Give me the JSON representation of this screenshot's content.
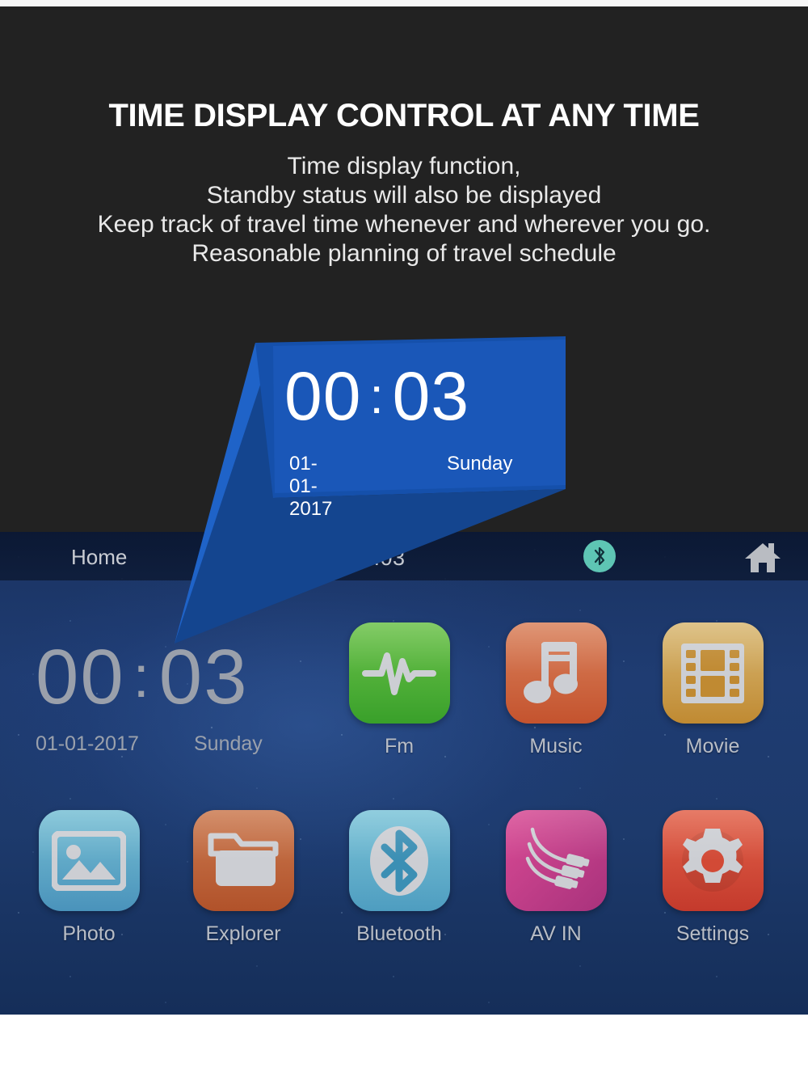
{
  "promo": {
    "title": "TIME DISPLAY CONTROL AT ANY TIME",
    "subtitle_lines": [
      "Time display function,",
      "Standby status will also be displayed",
      "Keep track of travel time whenever and wherever you go.",
      "Reasonable planning of travel schedule"
    ]
  },
  "callout": {
    "hours": "00",
    "separator": ":",
    "minutes": "03",
    "date": "01-01-2017",
    "weekday": "Sunday",
    "fill_color": "#1550ab",
    "edge_color": "#1f63c8"
  },
  "statusbar": {
    "home_label": "Home",
    "time": "0:03",
    "bluetooth_icon": "bluetooth-icon",
    "bluetooth_badge_color": "#5ec5b4",
    "home_icon": "home-icon"
  },
  "home_clock": {
    "hours": "00",
    "separator": ":",
    "minutes": "03",
    "date": "01-01-2017",
    "weekday": "Sunday",
    "text_color": "#9aa0ab"
  },
  "apps": [
    {
      "label": "Fm",
      "icon": "waveform-icon",
      "color_top": "#6cc24a",
      "color_bottom": "#39a02a"
    },
    {
      "label": "Music",
      "icon": "music-note-icon",
      "color_top": "#d9825c",
      "color_bottom": "#c4532e"
    },
    {
      "label": "Movie",
      "icon": "film-strip-icon",
      "color_top": "#d8b874",
      "color_bottom": "#c08a32"
    },
    {
      "label": "Photo",
      "icon": "picture-icon",
      "color_top": "#77bfd4",
      "color_bottom": "#4a93bb"
    },
    {
      "label": "Explorer",
      "icon": "folder-icon",
      "color_top": "#cb7a50",
      "color_bottom": "#b1522a"
    },
    {
      "label": "Bluetooth",
      "icon": "bluetooth-icon",
      "color_top": "#7cc4d8",
      "color_bottom": "#4e9dc0"
    },
    {
      "label": "AV IN",
      "icon": "rca-cable-icon",
      "color_top": "#d94a94",
      "color_bottom": "#a8327c"
    },
    {
      "label": "Settings",
      "icon": "gear-icon",
      "color_top": "#e2624a",
      "color_bottom": "#c43a2c"
    }
  ],
  "theme": {
    "promo_background": "#222222",
    "screen_background": "#1d3a6e",
    "icon_glyph_color": "#c9cbd0"
  }
}
